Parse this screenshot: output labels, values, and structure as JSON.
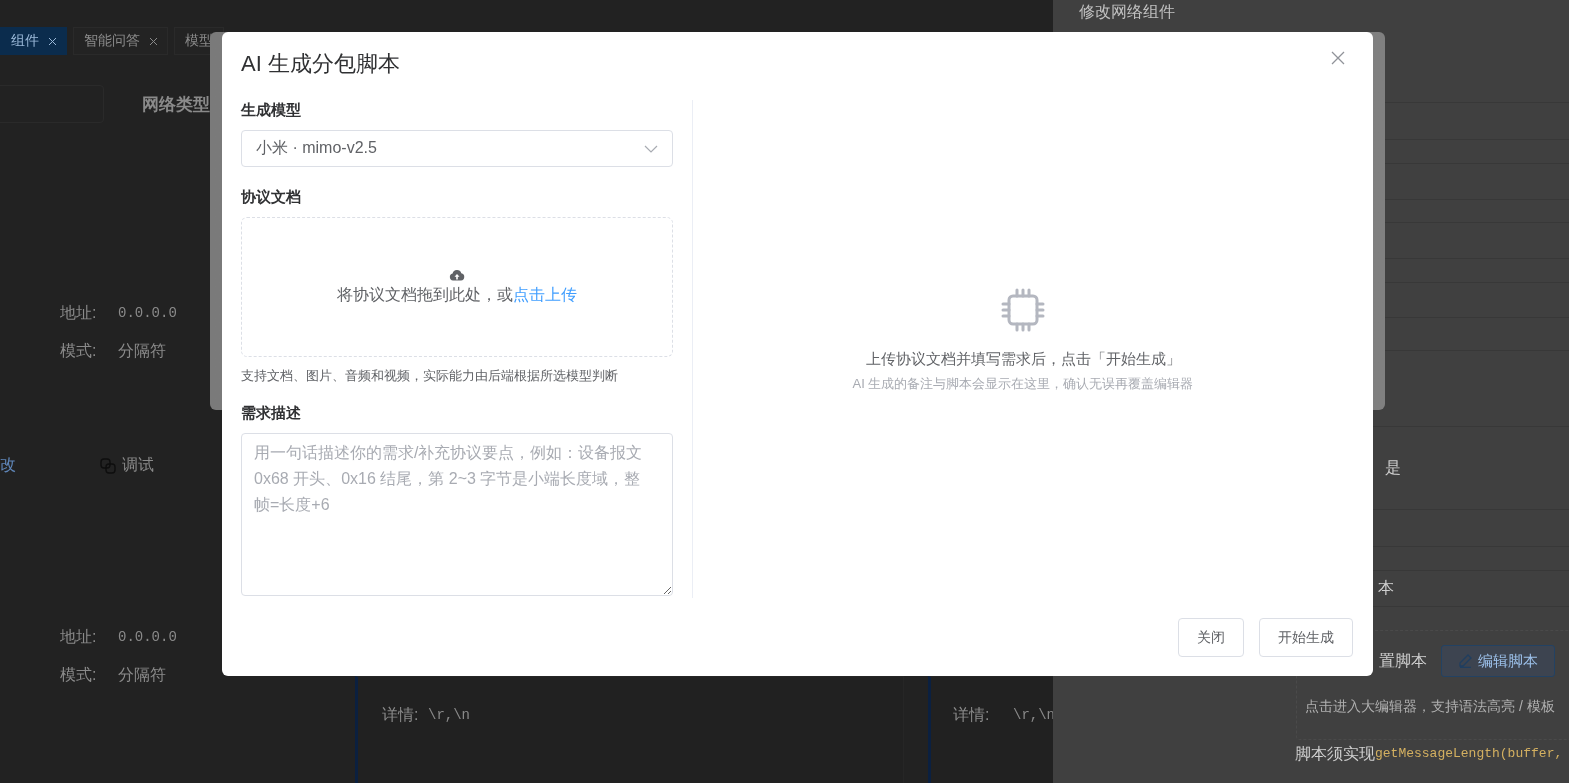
{
  "background": {
    "tabs": [
      {
        "label": "组件",
        "selected": true
      },
      {
        "label": "智能问答",
        "selected": false
      },
      {
        "label": "模型",
        "selected": false
      }
    ],
    "column_header": "网络类型",
    "field_groups": [
      {
        "fields": [
          {
            "label": "地址:",
            "value": "0.0.0.0"
          },
          {
            "label": "模式:",
            "value": "分隔符"
          }
        ]
      },
      {
        "fields": [
          {
            "label": "地址:",
            "value": "0.0.0.0"
          },
          {
            "label": "模式:",
            "value": "分隔符"
          }
        ]
      }
    ],
    "actions": [
      {
        "kind": "link",
        "label": "改"
      },
      {
        "kind": "debug",
        "label": "调试"
      }
    ],
    "details": [
      {
        "label": "详情:",
        "value": "\\r,\\n"
      },
      {
        "label": "详情:",
        "value": "\\r,\\n"
      }
    ]
  },
  "drawer": {
    "title": "修改网络组件",
    "value_yes": "是",
    "script_label_tail": "本",
    "config_label": "置脚本",
    "edit_button": "编辑脚本",
    "editor_hint": "点击进入大编辑器，支持语法高亮 / 模板",
    "requirement_label": "脚本须实现",
    "requirement_code": "getMessageLength(buffer,"
  },
  "dialog": {
    "title": "AI 生成分包脚本",
    "model": {
      "label": "生成模型",
      "value": "小米 · mimo-v2.5"
    },
    "document": {
      "label": "协议文档",
      "drop_text": "将协议文档拖到此处，或",
      "drop_link": "点击上传",
      "hint": "支持文档、图片、音频和视频，实际能力由后端根据所选模型判断"
    },
    "description": {
      "label": "需求描述",
      "placeholder": "用一句话描述你的需求/补充协议要点，例如：设备报文 0x68 开头、0x16 结尾，第 2~3 字节是小端长度域，整帧=长度+6"
    },
    "result": {
      "message": "上传协议文档并填写需求后，点击「开始生成」",
      "sub_message": "AI 生成的备注与脚本会显示在这里，确认无误再覆盖编辑器"
    },
    "buttons": [
      "关闭",
      "开始生成"
    ]
  }
}
